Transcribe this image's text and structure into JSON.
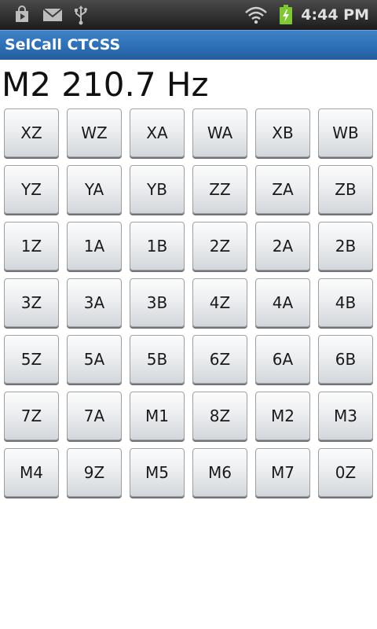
{
  "status_bar": {
    "time": "4:44 PM",
    "icons": [
      "play-store-icon",
      "mail-icon",
      "usb-icon",
      "wifi-icon",
      "battery-charging-icon"
    ]
  },
  "app": {
    "title": "SelCall CTCSS"
  },
  "readout": {
    "text": "M2 210.7 Hz"
  },
  "keys": [
    "XZ",
    "WZ",
    "XA",
    "WA",
    "XB",
    "WB",
    "YZ",
    "YA",
    "YB",
    "ZZ",
    "ZA",
    "ZB",
    "1Z",
    "1A",
    "1B",
    "2Z",
    "2A",
    "2B",
    "3Z",
    "3A",
    "3B",
    "4Z",
    "4A",
    "4B",
    "5Z",
    "5A",
    "5B",
    "6Z",
    "6A",
    "6B",
    "7Z",
    "7A",
    "M1",
    "8Z",
    "M2",
    "M3",
    "M4",
    "9Z",
    "M5",
    "M6",
    "M7",
    "0Z"
  ],
  "colors": {
    "title_bar": "#2d6fb6",
    "status_bar": "#1c1c1c",
    "battery": "#7ec832"
  }
}
